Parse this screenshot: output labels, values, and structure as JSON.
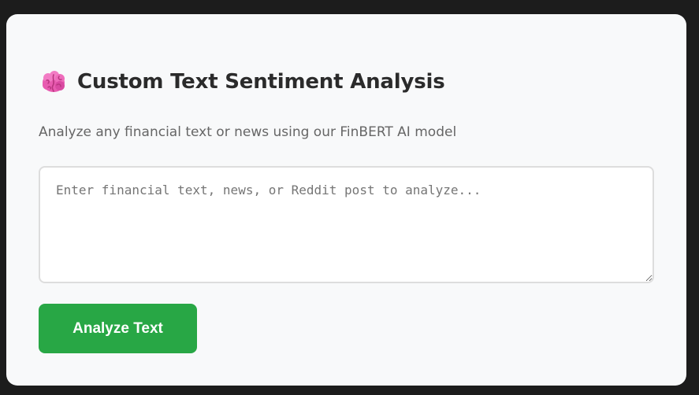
{
  "card": {
    "icon": "brain-icon",
    "title": "Custom Text Sentiment Analysis",
    "subtitle": "Analyze any financial text or news using our FinBERT AI model"
  },
  "input": {
    "value": "",
    "placeholder": "Enter financial text, news, or Reddit post to analyze..."
  },
  "actions": {
    "analyze_label": "Analyze Text"
  },
  "colors": {
    "page_background": "#1c1c1c",
    "card_background": "#f8f9fa",
    "button_green": "#28a745",
    "brain_pink": "#e85bb0"
  }
}
